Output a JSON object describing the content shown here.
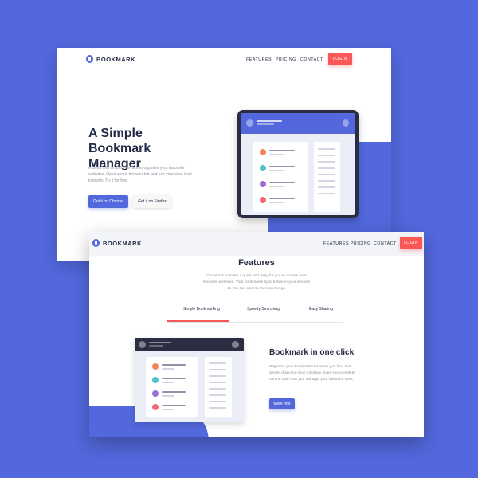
{
  "hero_page": {
    "logo_text": "BOOKMARK",
    "nav": {
      "features": "FEATURES",
      "pricing": "PRICING",
      "contact": "CONTACT",
      "login": "LOGIN"
    },
    "title_line1": "A Simple Bookmark",
    "title_line2": "Manager",
    "description": "A clean and simple interface to organize your favourite websites. Open a new browser tab and see your sites load instantly. Try it for free.",
    "btn_chrome": "Get it on Chrome",
    "btn_firefox": "Get it on Firefox"
  },
  "features_page": {
    "logo_text": "BOOKMARK",
    "nav": {
      "features": "FEATURES",
      "pricing": "PRICING",
      "contact": "CONTACT",
      "login": "LOGIN"
    },
    "title": "Features",
    "description": "Our aim is to make it quick and easy for you to access your favourite websites. Your bookmarks sync between your devices so you can access them on the go.",
    "tabs": [
      "Simple Bookmarking",
      "Speedy Searching",
      "Easy Sharing"
    ],
    "active_tab": "Simple Bookmarking",
    "feature_title": "Bookmark in one click",
    "feature_description": "Organize your bookmarks however you like. Our simple drag-and-drop interface gives you complete control over how you manage your favourite sites.",
    "more_info": "More Info"
  },
  "colors": {
    "background": "#5268dc",
    "primary": "#5268dc",
    "accent_red": "#fa5757",
    "dark_text": "#242a45",
    "muted_text": "#9194a1",
    "bookmark_dots": [
      "#f3845a",
      "#4fc2ce",
      "#9b6fd6",
      "#ee6b72"
    ]
  }
}
